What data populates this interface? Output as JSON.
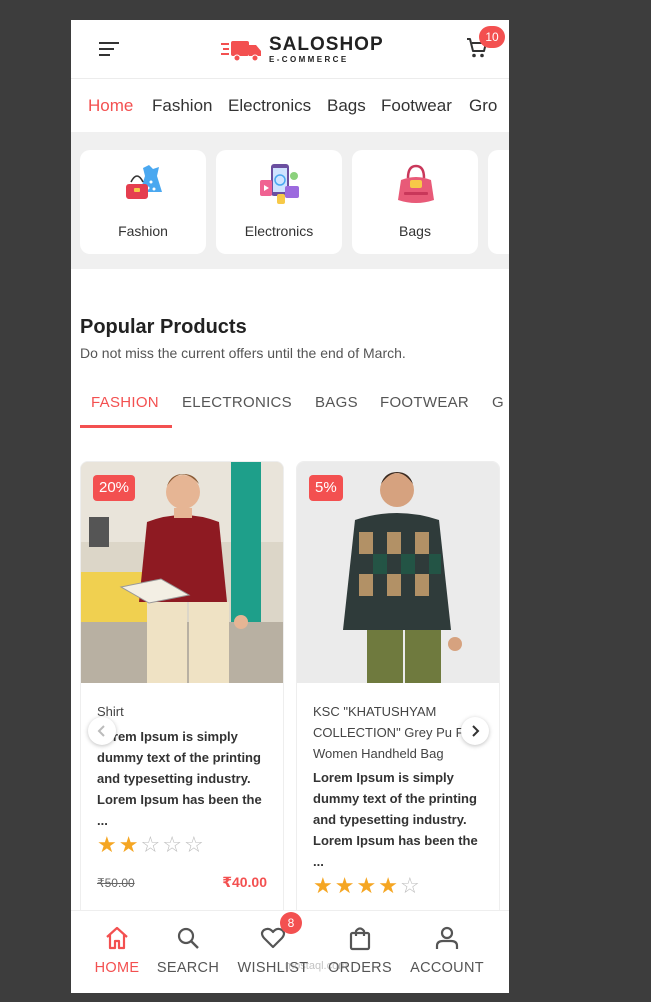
{
  "header": {
    "brand_name": "SALOSHOP",
    "brand_sub": "E-COMMERCE",
    "cart_count": "10",
    "icons": [
      "menu-icon",
      "truck-logo-icon",
      "cart-icon"
    ]
  },
  "category_nav": [
    "Home",
    "Fashion",
    "Electronics",
    "Bags",
    "Footwear",
    "Gro"
  ],
  "category_cards": [
    "Fashion",
    "Electronics",
    "Bags"
  ],
  "popular": {
    "title": "Popular Products",
    "subtitle": "Do not miss the current offers until the end of March."
  },
  "tabs": [
    "FASHION",
    "ELECTRONICS",
    "BAGS",
    "FOOTWEAR",
    "G"
  ],
  "products": [
    {
      "discount": "20%",
      "category": "Shirt",
      "description": "Lorem Ipsum is simply dummy text of the printing and typesetting industry. Lorem Ipsum has been the ...",
      "rating": 2,
      "old_price": "₹50.00",
      "new_price": "₹40.00"
    },
    {
      "discount": "5%",
      "category": "KSC \"KHATUSHYAM COLLECTION\" Grey Pu Fe Women Handheld Bag",
      "description": "Lorem Ipsum is simply dummy text of the printing and typesetting industry. Lorem Ipsum has been the ...",
      "rating": 4
    }
  ],
  "bottom_nav": [
    "HOME",
    "SEARCH",
    "WISHLIST",
    "ORDERS",
    "ACCOUNT"
  ],
  "wishlist_count": "8",
  "watermark": "mostaql.com",
  "colors": {
    "accent": "#f35050",
    "star": "#f5a623",
    "background": "#3d3d3d"
  }
}
